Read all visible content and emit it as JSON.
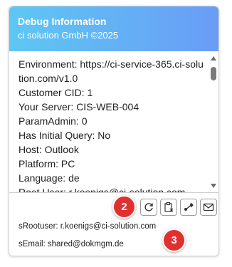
{
  "header": {
    "title": "Debug Information",
    "subtitle": "ci solution GmbH ©2025"
  },
  "info_lines": [
    "Environment: https://ci-service-365.ci-solution.com/v1.0",
    "Customer CID: 1",
    "Your Server: CIS-WEB-004",
    "ParamAdmin: 0",
    "Has Initial Query: No",
    "Host: Outlook",
    "Platform: PC",
    "Language: de",
    "Root User: r.koenigs@ci-solution.com"
  ],
  "toolbar": {
    "buttons": [
      {
        "icon": "refresh-icon"
      },
      {
        "icon": "clear-clipboard-icon"
      },
      {
        "icon": "share-icon"
      },
      {
        "icon": "mail-icon"
      }
    ]
  },
  "footer": {
    "root_user": "sRootuser: r.koenigs@ci-solution.com",
    "email": "sEmail: shared@dokmgm.de"
  },
  "badges": [
    "2",
    "3"
  ],
  "colors": {
    "header_gradient_start": "#5dc7f3",
    "header_gradient_end": "#6a9cf6",
    "badge": "#e03030"
  }
}
